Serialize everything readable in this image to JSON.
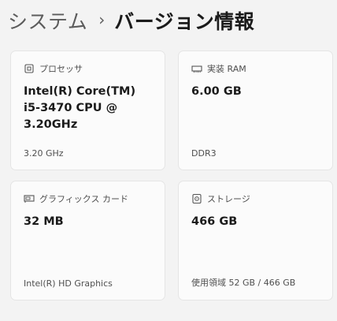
{
  "breadcrumb": {
    "parent": "システム",
    "separator": "›",
    "current": "バージョン情報"
  },
  "cards": {
    "processor": {
      "icon": "cpu-icon",
      "title": "プロセッサ",
      "value": "Intel(R) Core(TM) i5-3470 CPU @ 3.20GHz",
      "sub": "3.20 GHz"
    },
    "ram": {
      "icon": "memory-icon",
      "title": "実装 RAM",
      "value": "6.00 GB",
      "sub": "DDR3"
    },
    "gpu": {
      "icon": "graphics-card-icon",
      "title": "グラフィックス カード",
      "value": "32 MB",
      "sub": "Intel(R) HD Graphics"
    },
    "storage": {
      "icon": "storage-drive-icon",
      "title": "ストレージ",
      "value": "466 GB",
      "sub": "使用領域 52 GB / 466 GB"
    }
  }
}
